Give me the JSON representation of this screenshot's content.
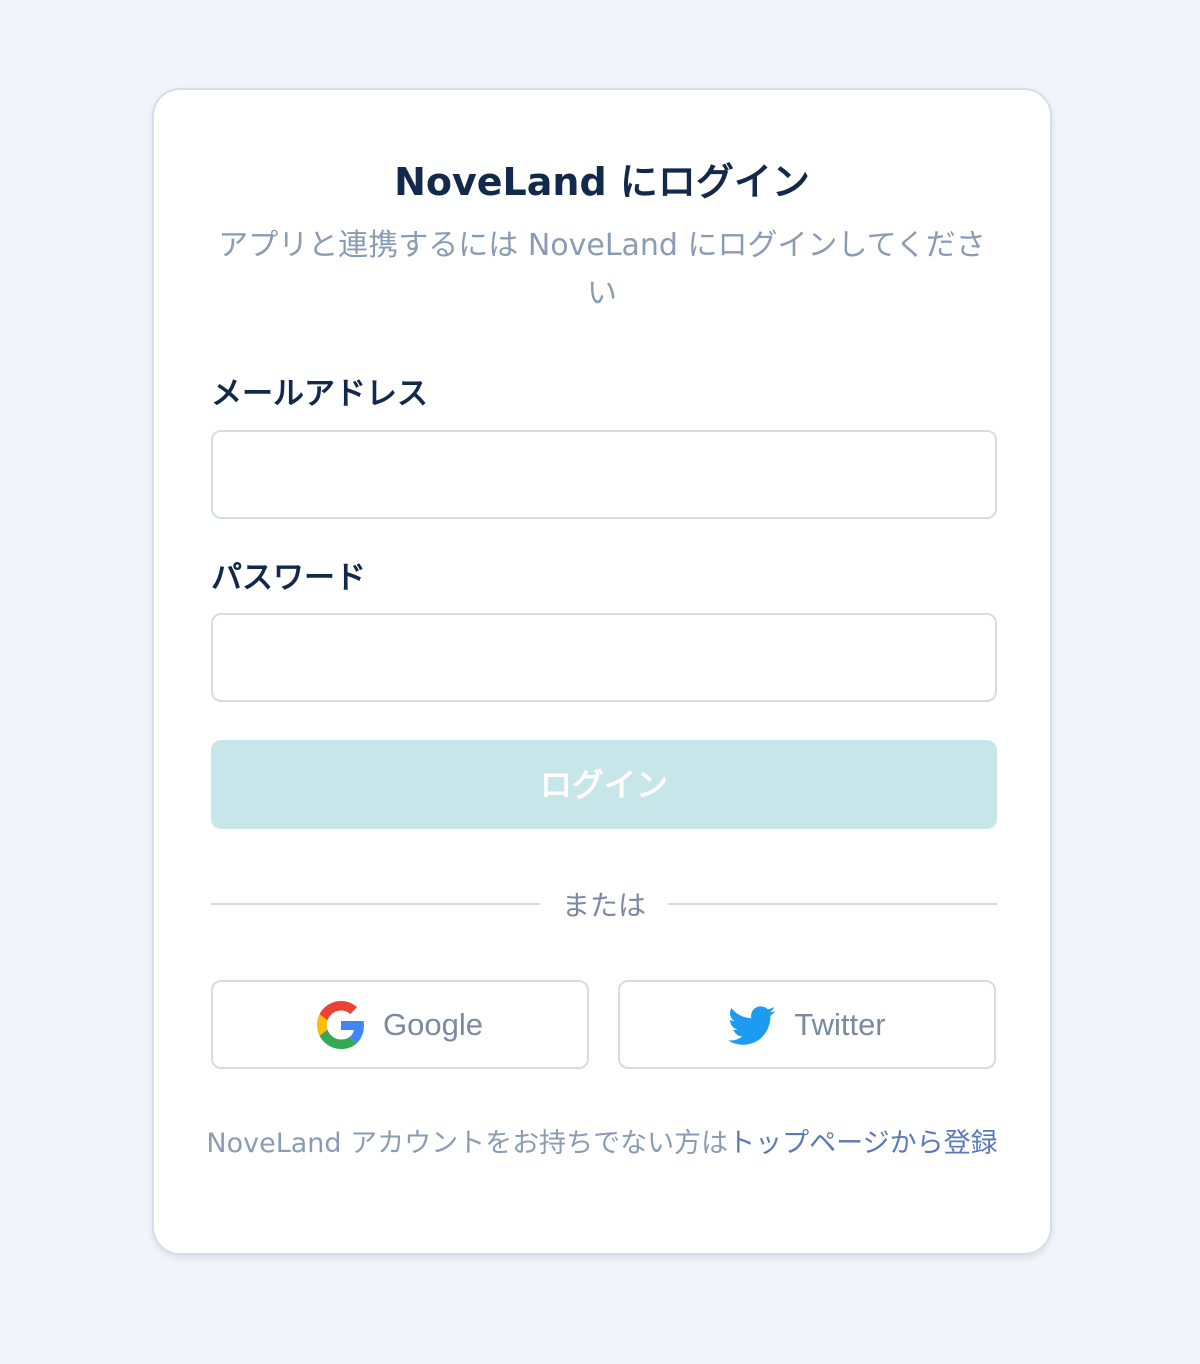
{
  "login": {
    "title": "NoveLand にログイン",
    "subtitle": "アプリと連携するには NoveLand にログインしてください",
    "email_label": "メールアドレス",
    "email_value": "",
    "password_label": "パスワード",
    "password_value": "",
    "submit_label": "ログイン",
    "divider_text": "または"
  },
  "social": {
    "google_label": "Google",
    "google_icon": "google-g-icon",
    "twitter_label": "Twitter",
    "twitter_icon": "twitter-bird-icon"
  },
  "footer": {
    "prefix": "NoveLand アカウントをお持ちでない方は",
    "link_text": "トップページから登録"
  },
  "colors": {
    "background": "#f1f4f8",
    "title": "#13294b",
    "muted": "#8a9bb4",
    "button_disabled": "#c7e6ea",
    "link": "#5a79b9",
    "twitter": "#1d9bf0"
  }
}
